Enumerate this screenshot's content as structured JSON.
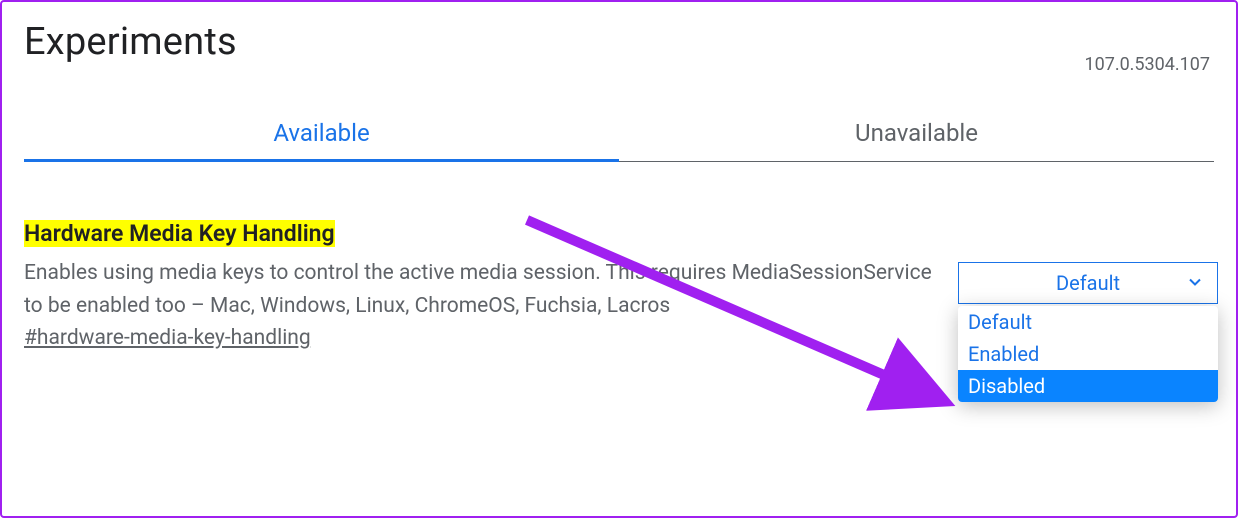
{
  "header": {
    "title": "Experiments",
    "version": "107.0.5304.107"
  },
  "tabs": {
    "available": "Available",
    "unavailable": "Unavailable"
  },
  "experiment": {
    "title": "Hardware Media Key Handling",
    "description": "Enables using media keys to control the active media session. This requires MediaSessionService to be enabled too – Mac, Windows, Linux, ChromeOS, Fuchsia, Lacros",
    "hash": "#hardware-media-key-handling",
    "select": {
      "current": "Default",
      "options": [
        "Default",
        "Enabled",
        "Disabled"
      ],
      "highlighted": "Disabled"
    }
  },
  "colors": {
    "accent": "#1a73e8",
    "annotation": "#a020f0"
  }
}
